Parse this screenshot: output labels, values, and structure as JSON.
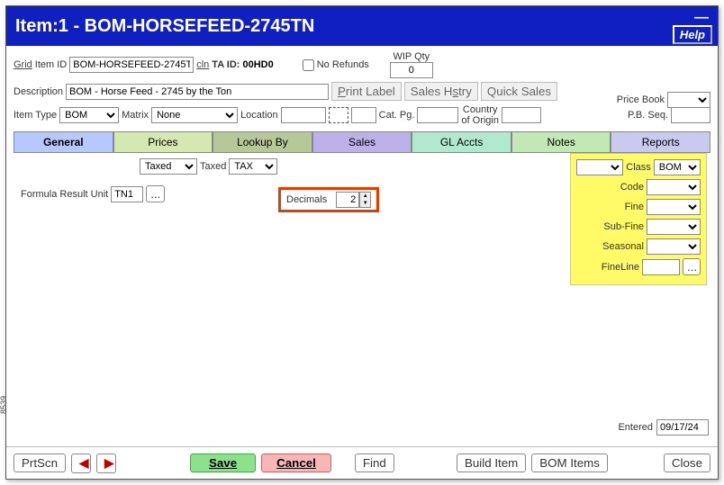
{
  "titlebar": {
    "text": "Item:1 - BOM-HORSEFEED-2745TN",
    "minimize": "—",
    "help": "Help"
  },
  "header": {
    "grid": "Grid",
    "item_id_label": "Item ID",
    "item_id": "BOM-HORSEFEED-2745TN",
    "cln": "cln",
    "ta_id_label": "TA ID:",
    "ta_id": "00HD0",
    "no_refunds": "No Refunds",
    "wip_qty_label": "WIP Qty",
    "wip_qty": "0",
    "desc_label": "Description",
    "desc": "BOM - Horse Feed - 2745 by the Ton",
    "print_label": "Print Label",
    "sales_hstry": "Sales Hstry",
    "quick_sales": "Quick Sales",
    "item_type_label": "Item Type",
    "item_type": "BOM",
    "matrix_label": "Matrix",
    "matrix": "None",
    "location_label": "Location",
    "cat_pg_label": "Cat. Pg.",
    "country_label": "Country of Origin",
    "price_book_label": "Price Book",
    "pb_seq_label": "P.B. Seq."
  },
  "tabs": {
    "general": "General",
    "prices": "Prices",
    "lookup": "Lookup By",
    "sales": "Sales",
    "glaccts": "GL Accts",
    "notes": "Notes",
    "reports": "Reports"
  },
  "general_panel": {
    "taxed1": "Taxed",
    "taxed2_label": "Taxed",
    "taxed2_value": "TAX",
    "formula_label": "Formula Result Unit",
    "formula_value": "TN1",
    "formula_more": "...",
    "decimals_label": "Decimals",
    "decimals_value": "2"
  },
  "yellow": {
    "class_label": "Class",
    "class_value": "BOM",
    "code_label": "Code",
    "fine_label": "Fine",
    "subfine_label": "Sub-Fine",
    "seasonal_label": "Seasonal",
    "fineline_label": "FineLine",
    "fineline_more": "..."
  },
  "footer": {
    "entered_label": "Entered",
    "entered_value": "09/17/24",
    "prtscn": "PrtScn",
    "prev": "◀",
    "next": "▶",
    "save": "Save",
    "cancel": "Cancel",
    "find": "Find",
    "build_item": "Build Item",
    "bom_items": "BOM Items",
    "close": "Close"
  },
  "side_text": "8539"
}
